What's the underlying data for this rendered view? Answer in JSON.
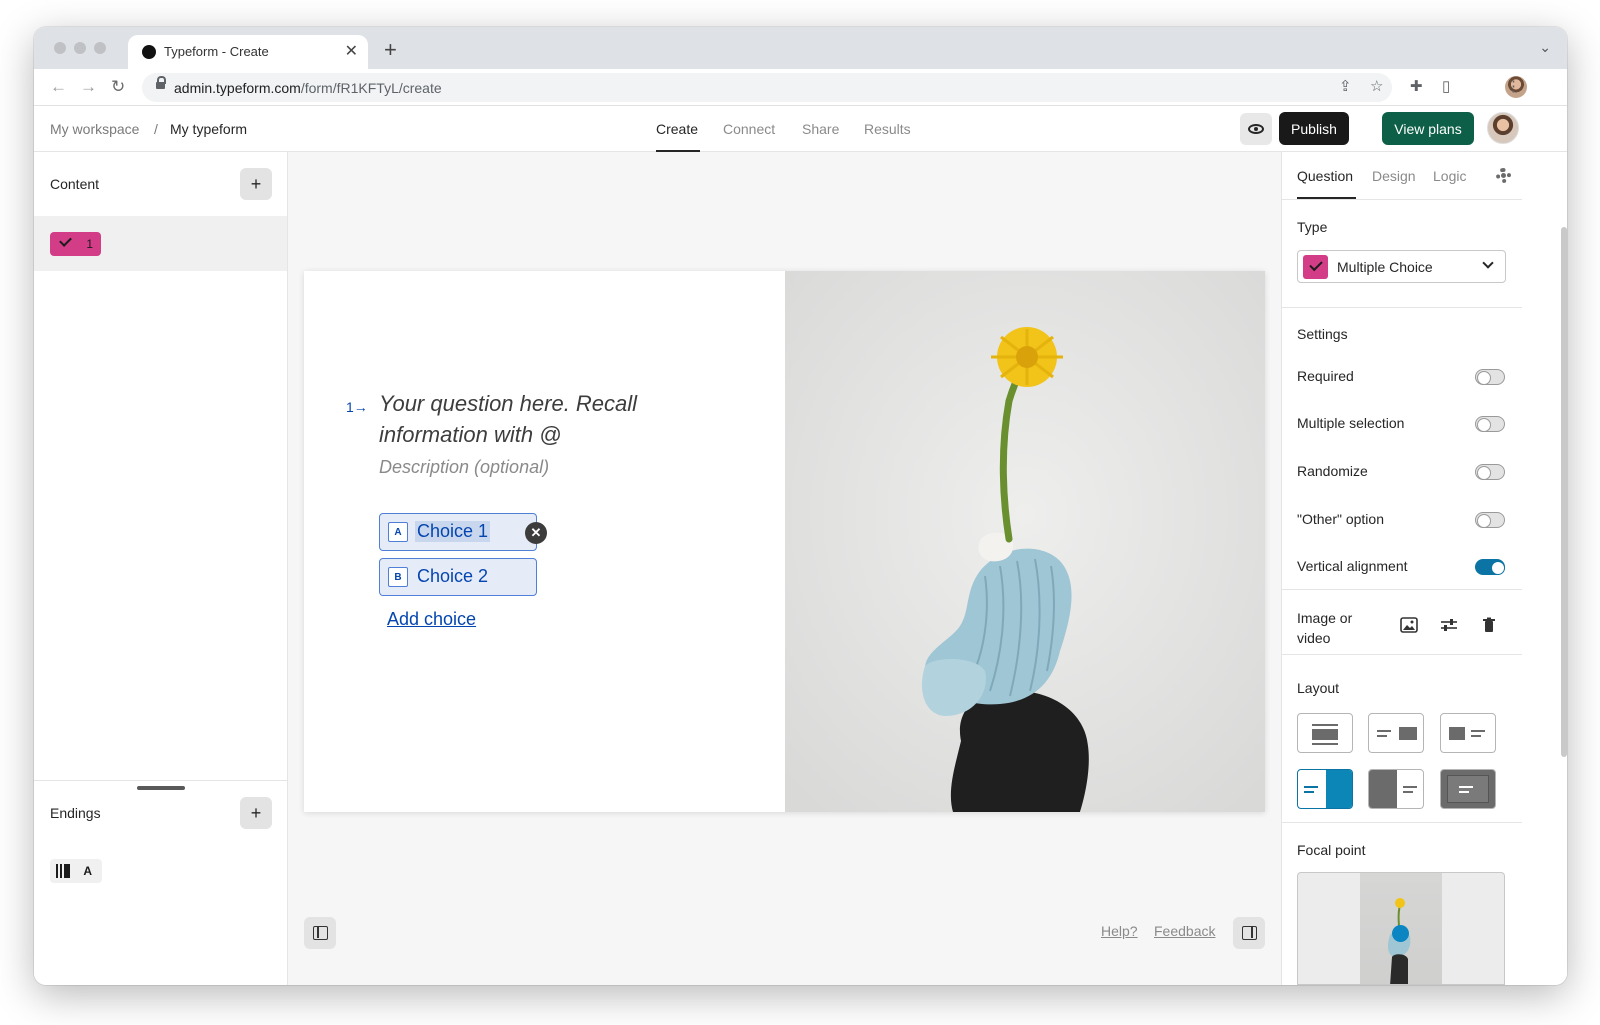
{
  "browser": {
    "tab_title": "Typeform - Create",
    "tab_close": "✕",
    "new_tab": "+",
    "url_host": "admin.typeform.com",
    "url_path": "/form/fR1KFTyL/create"
  },
  "header": {
    "workspace": "My workspace",
    "separator": "/",
    "form_name": "My typeform",
    "tabs": [
      {
        "label": "Create",
        "active": true
      },
      {
        "label": "Connect",
        "active": false
      },
      {
        "label": "Share",
        "active": false
      },
      {
        "label": "Results",
        "active": false
      }
    ],
    "publish_label": "Publish",
    "view_plans_label": "View plans",
    "view_plans_color": "#0d6047"
  },
  "left_panel": {
    "content_title": "Content",
    "add_symbol": "+",
    "question_number": "1",
    "question_color": "#d33c87",
    "endings_title": "Endings",
    "ending_letter": "A"
  },
  "canvas": {
    "question_number": "1",
    "question_arrow": "→",
    "question_text": "Your question here. Recall information with @",
    "description_placeholder": "Description (optional)",
    "choices": [
      {
        "key": "A",
        "label": "Choice 1",
        "selected": true
      },
      {
        "key": "B",
        "label": "Choice 2",
        "selected": false
      }
    ],
    "remove_symbol": "✕",
    "add_choice_label": "Add choice",
    "help_label": "Help?",
    "feedback_label": "Feedback"
  },
  "right_panel": {
    "tabs": [
      {
        "label": "Question",
        "active": true
      },
      {
        "label": "Design",
        "active": false
      },
      {
        "label": "Logic",
        "active": false
      }
    ],
    "type_title": "Type",
    "type_value": "Multiple Choice",
    "settings_title": "Settings",
    "settings": [
      {
        "label": "Required",
        "on": false
      },
      {
        "label": "Multiple selection",
        "on": false
      },
      {
        "label": "Randomize",
        "on": false
      },
      {
        "label": "\"Other\" option",
        "on": false
      },
      {
        "label": "Vertical alignment",
        "on": true
      }
    ],
    "media_title_line1": "Image or",
    "media_title_line2": "video",
    "layout_title": "Layout",
    "layout_selected_index": 3,
    "focal_title": "Focal point",
    "accent_color": "#0c74a4"
  }
}
